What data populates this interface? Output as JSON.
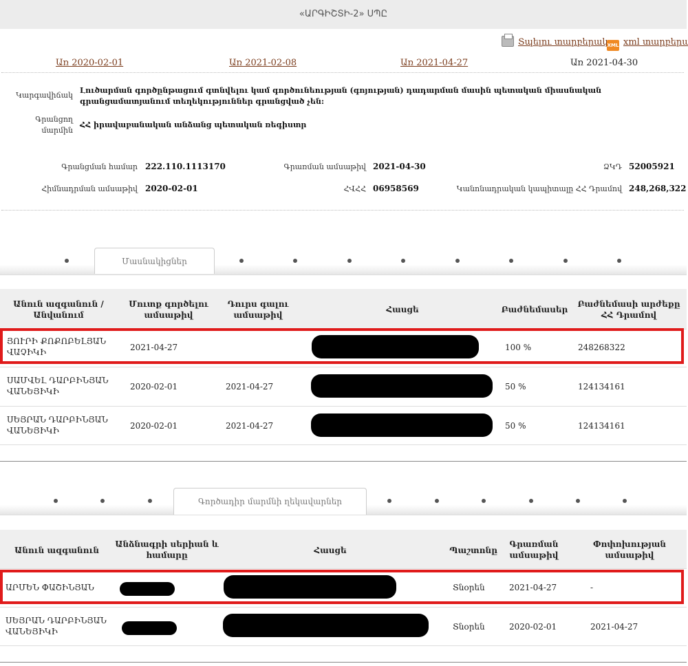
{
  "header": {
    "title": "«ԱՐԳԻՇՏԻ-2» ՍՊԸ"
  },
  "downloads": {
    "print_label": "Տպելու տարբերակ",
    "print_icon": "printer-icon",
    "xml_label": "xml տարբերակ",
    "xml_icon": "xml-file-icon",
    "xml_icon_text": "XML"
  },
  "dates": {
    "d1": "Առ 2020-02-01",
    "d2": "Առ 2021-02-08",
    "d3": "Առ 2021-04-27",
    "current": "Առ 2021-04-30"
  },
  "info": {
    "status_label": "Կարգավիճակ",
    "status_value": "Լուծարման գործընթացում գտնվելու կամ գործունեության (գոյության) դադարման մասին պետական միասնական գրանցամատյանում տեղեկություններ գրանցված չեն:",
    "body_label": "Գրանցող մարմին",
    "body_value": "ՀՀ իրավաբանական անձանց պետական ռեգիստր"
  },
  "details": {
    "reg_num_label": "Գրանցման համար",
    "reg_num": "222.110.1113170",
    "reg_date_label": "Գրառման ամսաթիվ",
    "reg_date": "2021-04-30",
    "zkd_label": "ՁԿԴ",
    "zkd": "52005921",
    "found_label": "Հիմնադրման ամսաթիվ",
    "found_date": "2020-02-01",
    "hvhh_label": "ՀՎՀՀ",
    "hvhh": "06958569",
    "capital_label": "Կանոնադրական կապիտալը ՀՀ Դրամով",
    "capital": "248,268,322"
  },
  "participants": {
    "tab_label": "Մասնակիցներ",
    "columns": [
      "Անուն ազգանուն / Անվանում",
      "Մուտք գործելու ամսաթիվ",
      "Դուրս գալու ամսաթիվ",
      "Հասցե",
      "Բաժնեմասեր",
      "Բաժնեմասի արժեքը ՀՀ Դրամով"
    ],
    "rows": [
      {
        "name": "ՅՈՒՐԻ ՔՈՔՈԲԵԼՅԱՆ ՎԱՉԻԿԻ",
        "entry": "2021-04-27",
        "exit": "",
        "share": "100 %",
        "value": "248268322"
      },
      {
        "name": "ՍԱՄՎԵԼ ԴԱՐԲԻՆՅԱՆ ՎԱՆԵՅԻԿԻ",
        "entry": "2020-02-01",
        "exit": "2021-04-27",
        "share": "50 %",
        "value": "124134161"
      },
      {
        "name": "ՍԵՅՐԱՆ ԴԱՐԲԻՆՅԱՆ ՎԱՆԵՅԻԿԻ",
        "entry": "2020-02-01",
        "exit": "2021-04-27",
        "share": "50 %",
        "value": "124134161"
      }
    ]
  },
  "managers": {
    "tab_label": "Գործադիր մարմնի ղեկավարներ",
    "columns": [
      "Անուն ազգանուն",
      "Անձնագրի սերիան և համարը",
      "Հասցե",
      "Պաշտոնը",
      "Գրառման ամսաթիվ",
      "Փոփոխության ամսաթիվ"
    ],
    "rows": [
      {
        "name": "ԱՐՄԵՆ ՓԱՇԻՆՅԱՆ",
        "position": "Տնօրեն",
        "date": "2021-04-27",
        "changed": "-"
      },
      {
        "name": "ՍԵՅՐԱՆ ԴԱՐԲԻՆՅԱՆ ՎԱՆԵՅԻԿԻ",
        "position": "Տնօրեն",
        "date": "2020-02-01",
        "changed": "2021-04-27"
      }
    ]
  },
  "colors": {
    "link": "#7a3b1b",
    "highlight": "#e01b1b",
    "redaction": "#000000"
  }
}
